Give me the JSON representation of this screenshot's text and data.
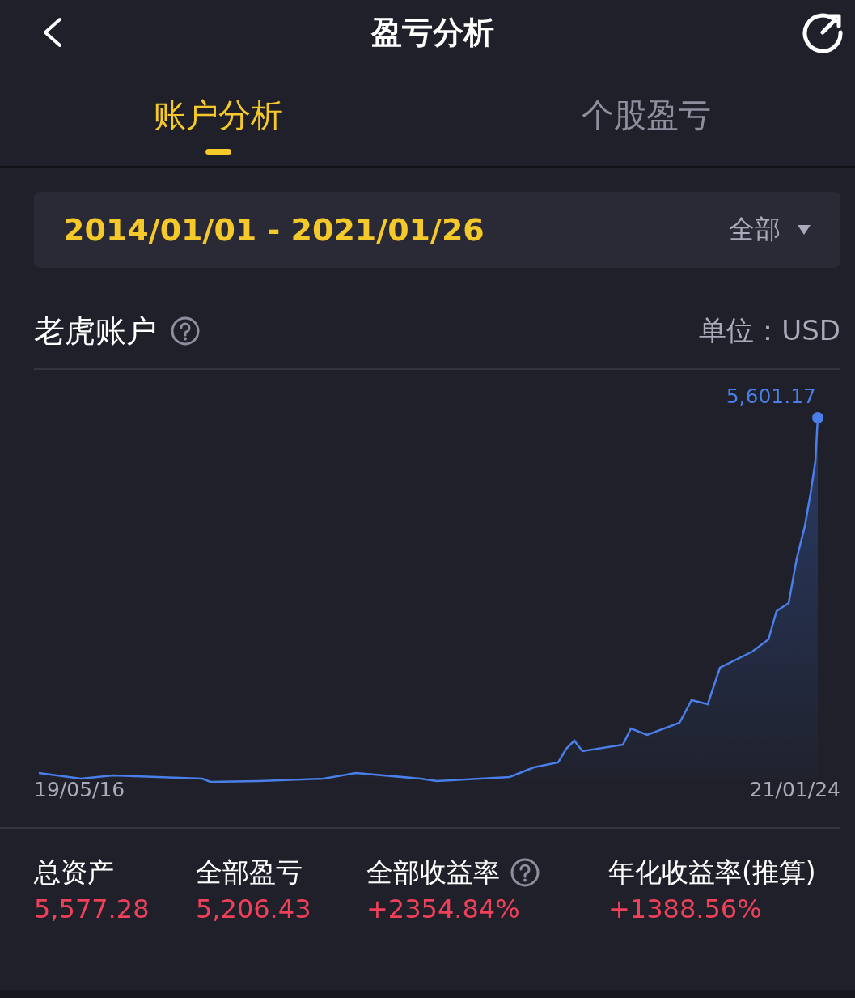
{
  "header": {
    "title": "盈亏分析"
  },
  "tabs": [
    {
      "label": "账户分析",
      "selected": true
    },
    {
      "label": "个股盈亏",
      "selected": false
    }
  ],
  "date_range": {
    "value": "2014/01/01 - 2021/01/26",
    "filter": "全部"
  },
  "account": {
    "title": "老虎账户",
    "help": true,
    "unit": "单位：USD"
  },
  "chart": {
    "peak_label": "5,601.17",
    "x_start": "19/05/16",
    "x_end": "21/01/24"
  },
  "stats": [
    {
      "label": "总资产",
      "value": "5,577.28",
      "help": false
    },
    {
      "label": "全部盈亏",
      "value": "5,206.43",
      "help": false
    },
    {
      "label": "全部收益率",
      "value": "+2354.84%",
      "help": true
    },
    {
      "label": "年化收益率(推算)",
      "value": "+1388.56%",
      "help": false
    }
  ]
}
